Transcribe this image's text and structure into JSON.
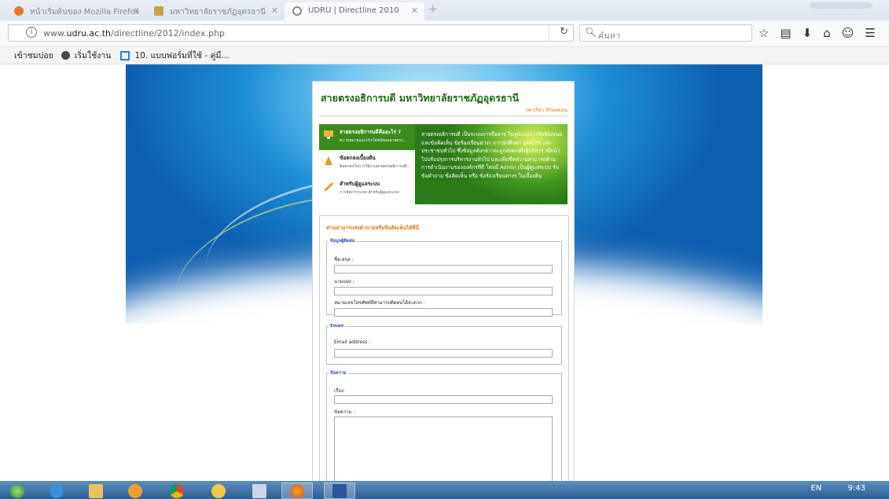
{
  "browser": {
    "tabs": [
      {
        "label": "หน้าเริ่มต้นของ Mozilla Firefox",
        "active": false,
        "color": "#e8772e"
      },
      {
        "label": "มหาวิทยาลัยราชภัฏอุดรธานี",
        "active": false,
        "color": "#c9a14a"
      },
      {
        "label": "UDRU | Directline 2010",
        "active": true,
        "color": "#888888"
      }
    ],
    "url_prefix": "www.",
    "url_host": "udru.ac.th",
    "url_path": "/directline/2012/index.php",
    "search_placeholder": "ค้นหา",
    "bookmarks": {
      "most_visited": "เข้าชมบ่อย",
      "getting_started": "เริ่มใช้งาน",
      "form_link": "10. แบบฟอร์มที่ใช้ - คู่มื..."
    },
    "icons": [
      "info-icon",
      "reload-icon",
      "search-icon",
      "star-icon",
      "reading-list-icon",
      "download-icon",
      "home-icon",
      "chat-icon",
      "menu-icon"
    ]
  },
  "page": {
    "title": "สายตรงอธิการบดี มหาวิทยาลัยราชภัฏอุดรธานี",
    "subtitle": "รศ.ปรีชา ทีกัณฑเสน",
    "menu": [
      {
        "title": "สายตรงอธิการบดีคืออะไร ?",
        "desc": "ความหมายและประโยชน์ของสายตรง...",
        "selected": true
      },
      {
        "title": "ข้อตกลงเบื้องต้น",
        "desc": "ข้อตกลงในการใช้งานสายตรงอธิการบดี...",
        "selected": false
      },
      {
        "title": "สำหรับผู้ดูแลระบบ",
        "desc": "การจัดการระบบ สำหรับผู้ดูแลระบบ",
        "selected": false
      }
    ],
    "banner_text": "สายตรงอธิการบดี เป็นระบบการสื่อสาร ในรูปแบบการรับข้อเสนอและข้อคิดเห็น ข้อร้องเรียนต่างๆ จากนักศึกษา บุคลากร และประชาชนทั่วไป ซึ่งข้อมูลดังกล่าวจะถูกส่งตรงถึงผู้บริหาร เพื่อนำไปปรับปรุงการบริหารงานทั่วไป และเพิ่มขีดความสามารถด้านการดำเนินงานขององค์กรที่ดี โดยมี Admin เป็นผู้ดูแลระบบ รับข้อคำถาม ข้อคิดเห็น หรือ ข้อร้องเรียนต่างๆ ในเบื้องต้น",
    "form": {
      "heading": "ท่านสามารถส่งคำถามหรือข้อคิดเห็นได้ที่นี่",
      "personal": {
        "legend": "ข้อมูลผู้ติดต่อ",
        "name_label": "ชื่อ-สกุล :",
        "nickname_label": "นามแฝง :",
        "phone_label": "หมายเลขโทรศัพท์ที่สามารถติดต่อได้สะดวก :"
      },
      "email": {
        "legend": "Email",
        "email_label": "Email address :"
      },
      "message": {
        "legend": "ข้อความ",
        "subject_label": "เรื่อง:",
        "body_label": "ข้อความ :"
      }
    }
  },
  "taskbar": {
    "lang": "EN",
    "time": "9:43"
  }
}
